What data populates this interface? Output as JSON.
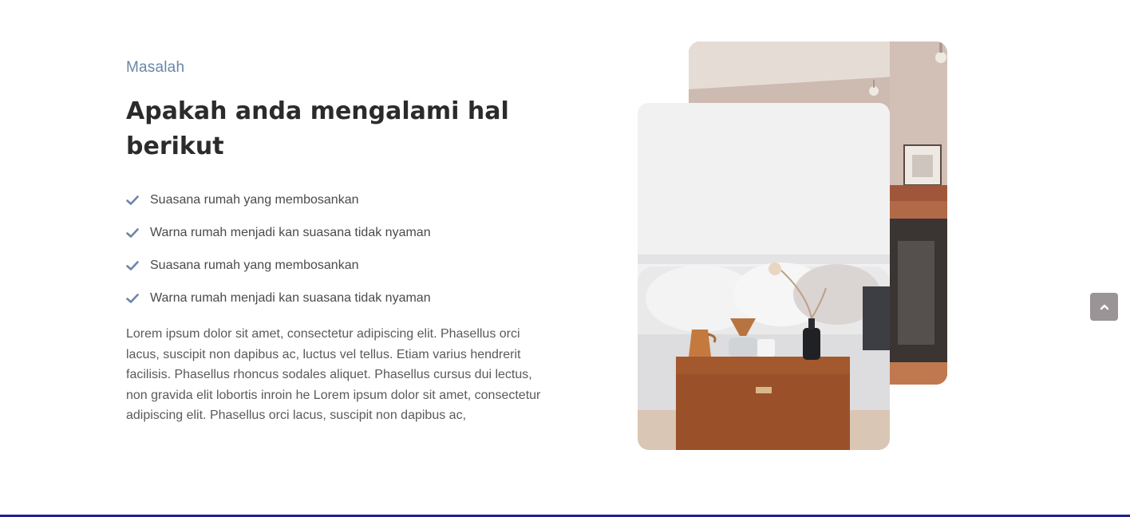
{
  "section": {
    "eyebrow": "Masalah",
    "title": "Apakah anda mengalami hal berikut",
    "items": [
      {
        "label": "Suasana rumah yang membosankan"
      },
      {
        "label": "Warna rumah menjadi kan suasana tidak nyaman"
      },
      {
        "label": "Suasana rumah yang membosankan"
      },
      {
        "label": "Warna rumah menjadi kan suasana tidak nyaman"
      }
    ],
    "body": "Lorem ipsum dolor sit amet, consectetur adipiscing elit. Phasellus orci lacus, suscipit non dapibus ac, luctus vel tellus. Etiam varius hendrerit facilisis. Phasellus rhoncus sodales aliquet. Phasellus cursus dui lectus, non gravida elit lobortis inroin he Lorem ipsum dolor sit amet, consectetur adipiscing elit. Phasellus orci lacus, suscipit non dapibus ac,"
  },
  "icons": {
    "list_check": "check-icon",
    "scroll_top": "chevron-up-icon"
  },
  "colors": {
    "eyebrow": "#6b86a8",
    "title": "#2d2a2a",
    "check": "#6b86a8",
    "scroll_button": "#9a9496",
    "bottom_line": "#1f1f8f"
  }
}
